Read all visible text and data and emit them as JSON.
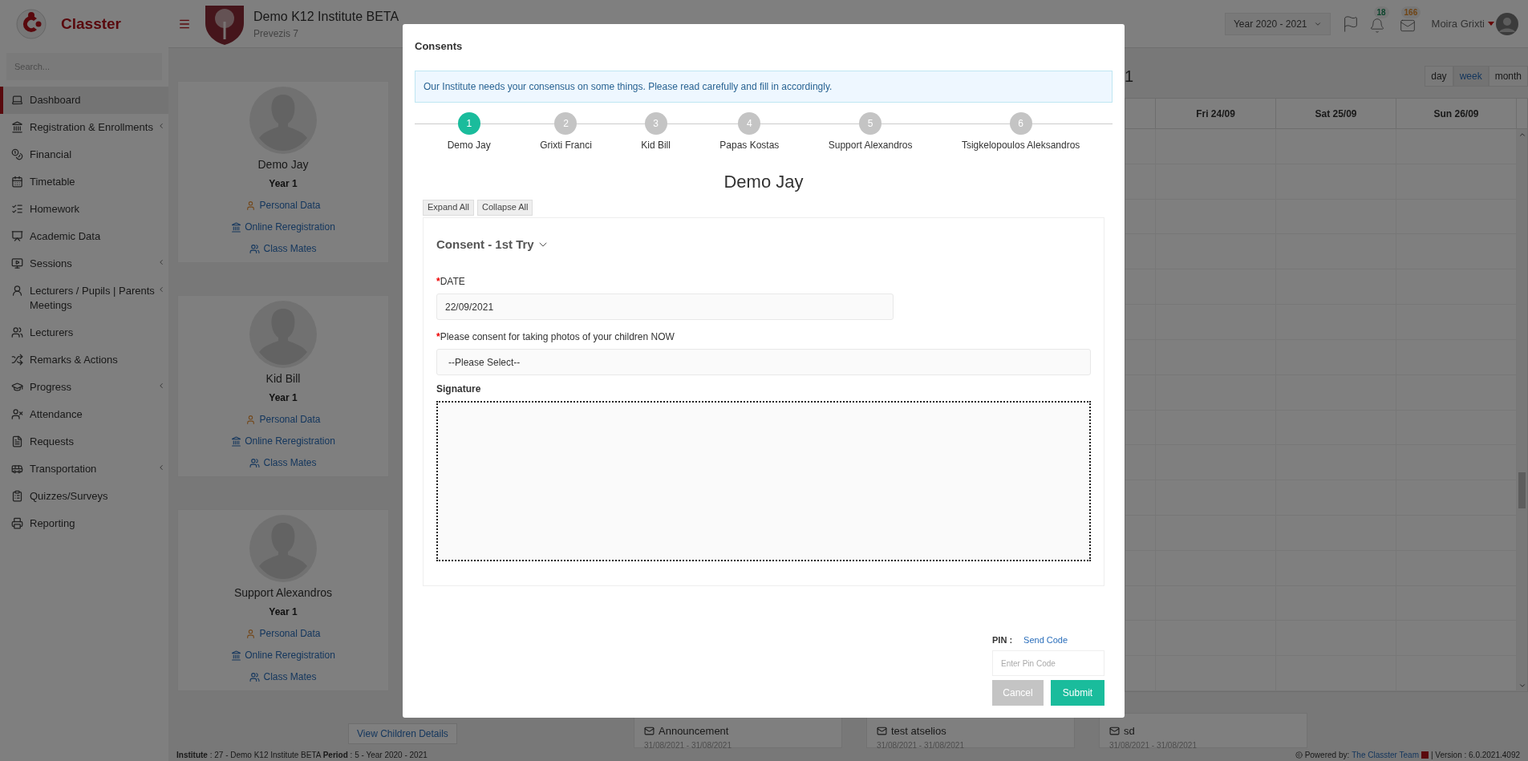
{
  "app": {
    "brand": "Classter",
    "search_placeholder": "Search..."
  },
  "sidebar": {
    "items": [
      {
        "label": "Dashboard",
        "selected": true,
        "submenu": false
      },
      {
        "label": "Registration & Enrollments",
        "selected": false,
        "submenu": true
      },
      {
        "label": "Financial",
        "selected": false,
        "submenu": false
      },
      {
        "label": "Timetable",
        "selected": false,
        "submenu": false
      },
      {
        "label": "Homework",
        "selected": false,
        "submenu": false
      },
      {
        "label": "Academic Data",
        "selected": false,
        "submenu": false
      },
      {
        "label": "Sessions",
        "selected": false,
        "submenu": true
      },
      {
        "label": "Lecturers / Pupils | Parents Meetings",
        "selected": false,
        "submenu": true
      },
      {
        "label": "Lecturers",
        "selected": false,
        "submenu": false
      },
      {
        "label": "Remarks & Actions",
        "selected": false,
        "submenu": false
      },
      {
        "label": "Progress",
        "selected": false,
        "submenu": true
      },
      {
        "label": "Attendance",
        "selected": false,
        "submenu": false
      },
      {
        "label": "Requests",
        "selected": false,
        "submenu": false
      },
      {
        "label": "Transportation",
        "selected": false,
        "submenu": true
      },
      {
        "label": "Quizzes/Surveys",
        "selected": false,
        "submenu": false
      },
      {
        "label": "Reporting",
        "selected": false,
        "submenu": false
      }
    ]
  },
  "header": {
    "institute": "Demo K12 Institute BETA",
    "address": "Prevezis 7",
    "year": "Year 2020 - 2021",
    "notifications": "18",
    "messages": "166",
    "user": "Moira Grixti"
  },
  "children": [
    {
      "name": "Demo Jay",
      "year": "Year 1",
      "links": [
        {
          "kind": "personal",
          "label": "Personal Data"
        },
        {
          "kind": "registration",
          "label": "Online Reregistration"
        },
        {
          "kind": "classmates",
          "label": "Class Mates"
        }
      ]
    },
    {
      "name": "Kid Bill",
      "year": "Year 1",
      "links": [
        {
          "kind": "personal",
          "label": "Personal Data"
        },
        {
          "kind": "registration",
          "label": "Online Reregistration"
        },
        {
          "kind": "classmates",
          "label": "Class Mates"
        }
      ]
    },
    {
      "name": "Support Alexandros",
      "year": "Year 1",
      "links": [
        {
          "kind": "personal",
          "label": "Personal Data"
        },
        {
          "kind": "registration",
          "label": "Online Reregistration"
        },
        {
          "kind": "classmates",
          "label": "Class Mates"
        }
      ]
    }
  ],
  "view_children_button": "View Children Details",
  "calendar": {
    "title_fragment": "1",
    "views": [
      {
        "label": "day",
        "selected": false
      },
      {
        "label": "week",
        "selected": true
      },
      {
        "label": "month",
        "selected": false
      }
    ],
    "columns": [
      "Fri 24/09",
      "Sat 25/09",
      "Sun 26/09"
    ]
  },
  "announcements": [
    {
      "title": "Announcement",
      "dates": "31/08/2021 - 31/08/2021"
    },
    {
      "title": "test atselios",
      "dates": "31/08/2021 - 31/08/2021"
    },
    {
      "title": "sd",
      "dates": "31/08/2021 - 31/08/2021"
    }
  ],
  "status_bar": {
    "left": "**Institute** : 27 - Demo K12 Institute BETA **Period** : 5 - Year 2020 - 2021",
    "powered": "Powered by:",
    "team": "The Classter Team",
    "version": "| Version : 6.0.2021.4092"
  },
  "modal": {
    "title": "Consents",
    "info": "Our Institute needs your consensus on some things. Please read carefully and fill in accordingly.",
    "steps": [
      {
        "number": "1",
        "label": "Demo Jay",
        "selected": true
      },
      {
        "number": "2",
        "label": "Grixti Franci",
        "selected": false
      },
      {
        "number": "3",
        "label": "Kid Bill",
        "selected": false
      },
      {
        "number": "4",
        "label": "Papas Kostas",
        "selected": false
      },
      {
        "number": "5",
        "label": "Support Alexandros",
        "selected": false
      },
      {
        "number": "6",
        "label": "Tsigkelopoulos Aleksandros",
        "selected": false
      }
    ],
    "student": "Demo Jay",
    "expand_all": "Expand All",
    "collapse_all": "Collapse All",
    "section": {
      "title": "Consent - 1st Try",
      "expanded": true,
      "fields": [
        {
          "kind": "text",
          "label": "DATE",
          "required": true,
          "value": "22/09/2021"
        },
        {
          "kind": "select",
          "label": "Please consent for taking photos of your children NOW",
          "required": true,
          "value": "--Please Select--"
        },
        {
          "kind": "signature",
          "label": "Signature",
          "required": false
        }
      ]
    },
    "required_mark": "*",
    "pin_label": "PIN :",
    "send_code": "Send Code",
    "pin_placeholder": "Enter Pin Code",
    "cancel": "Cancel",
    "submit": "Submit"
  }
}
